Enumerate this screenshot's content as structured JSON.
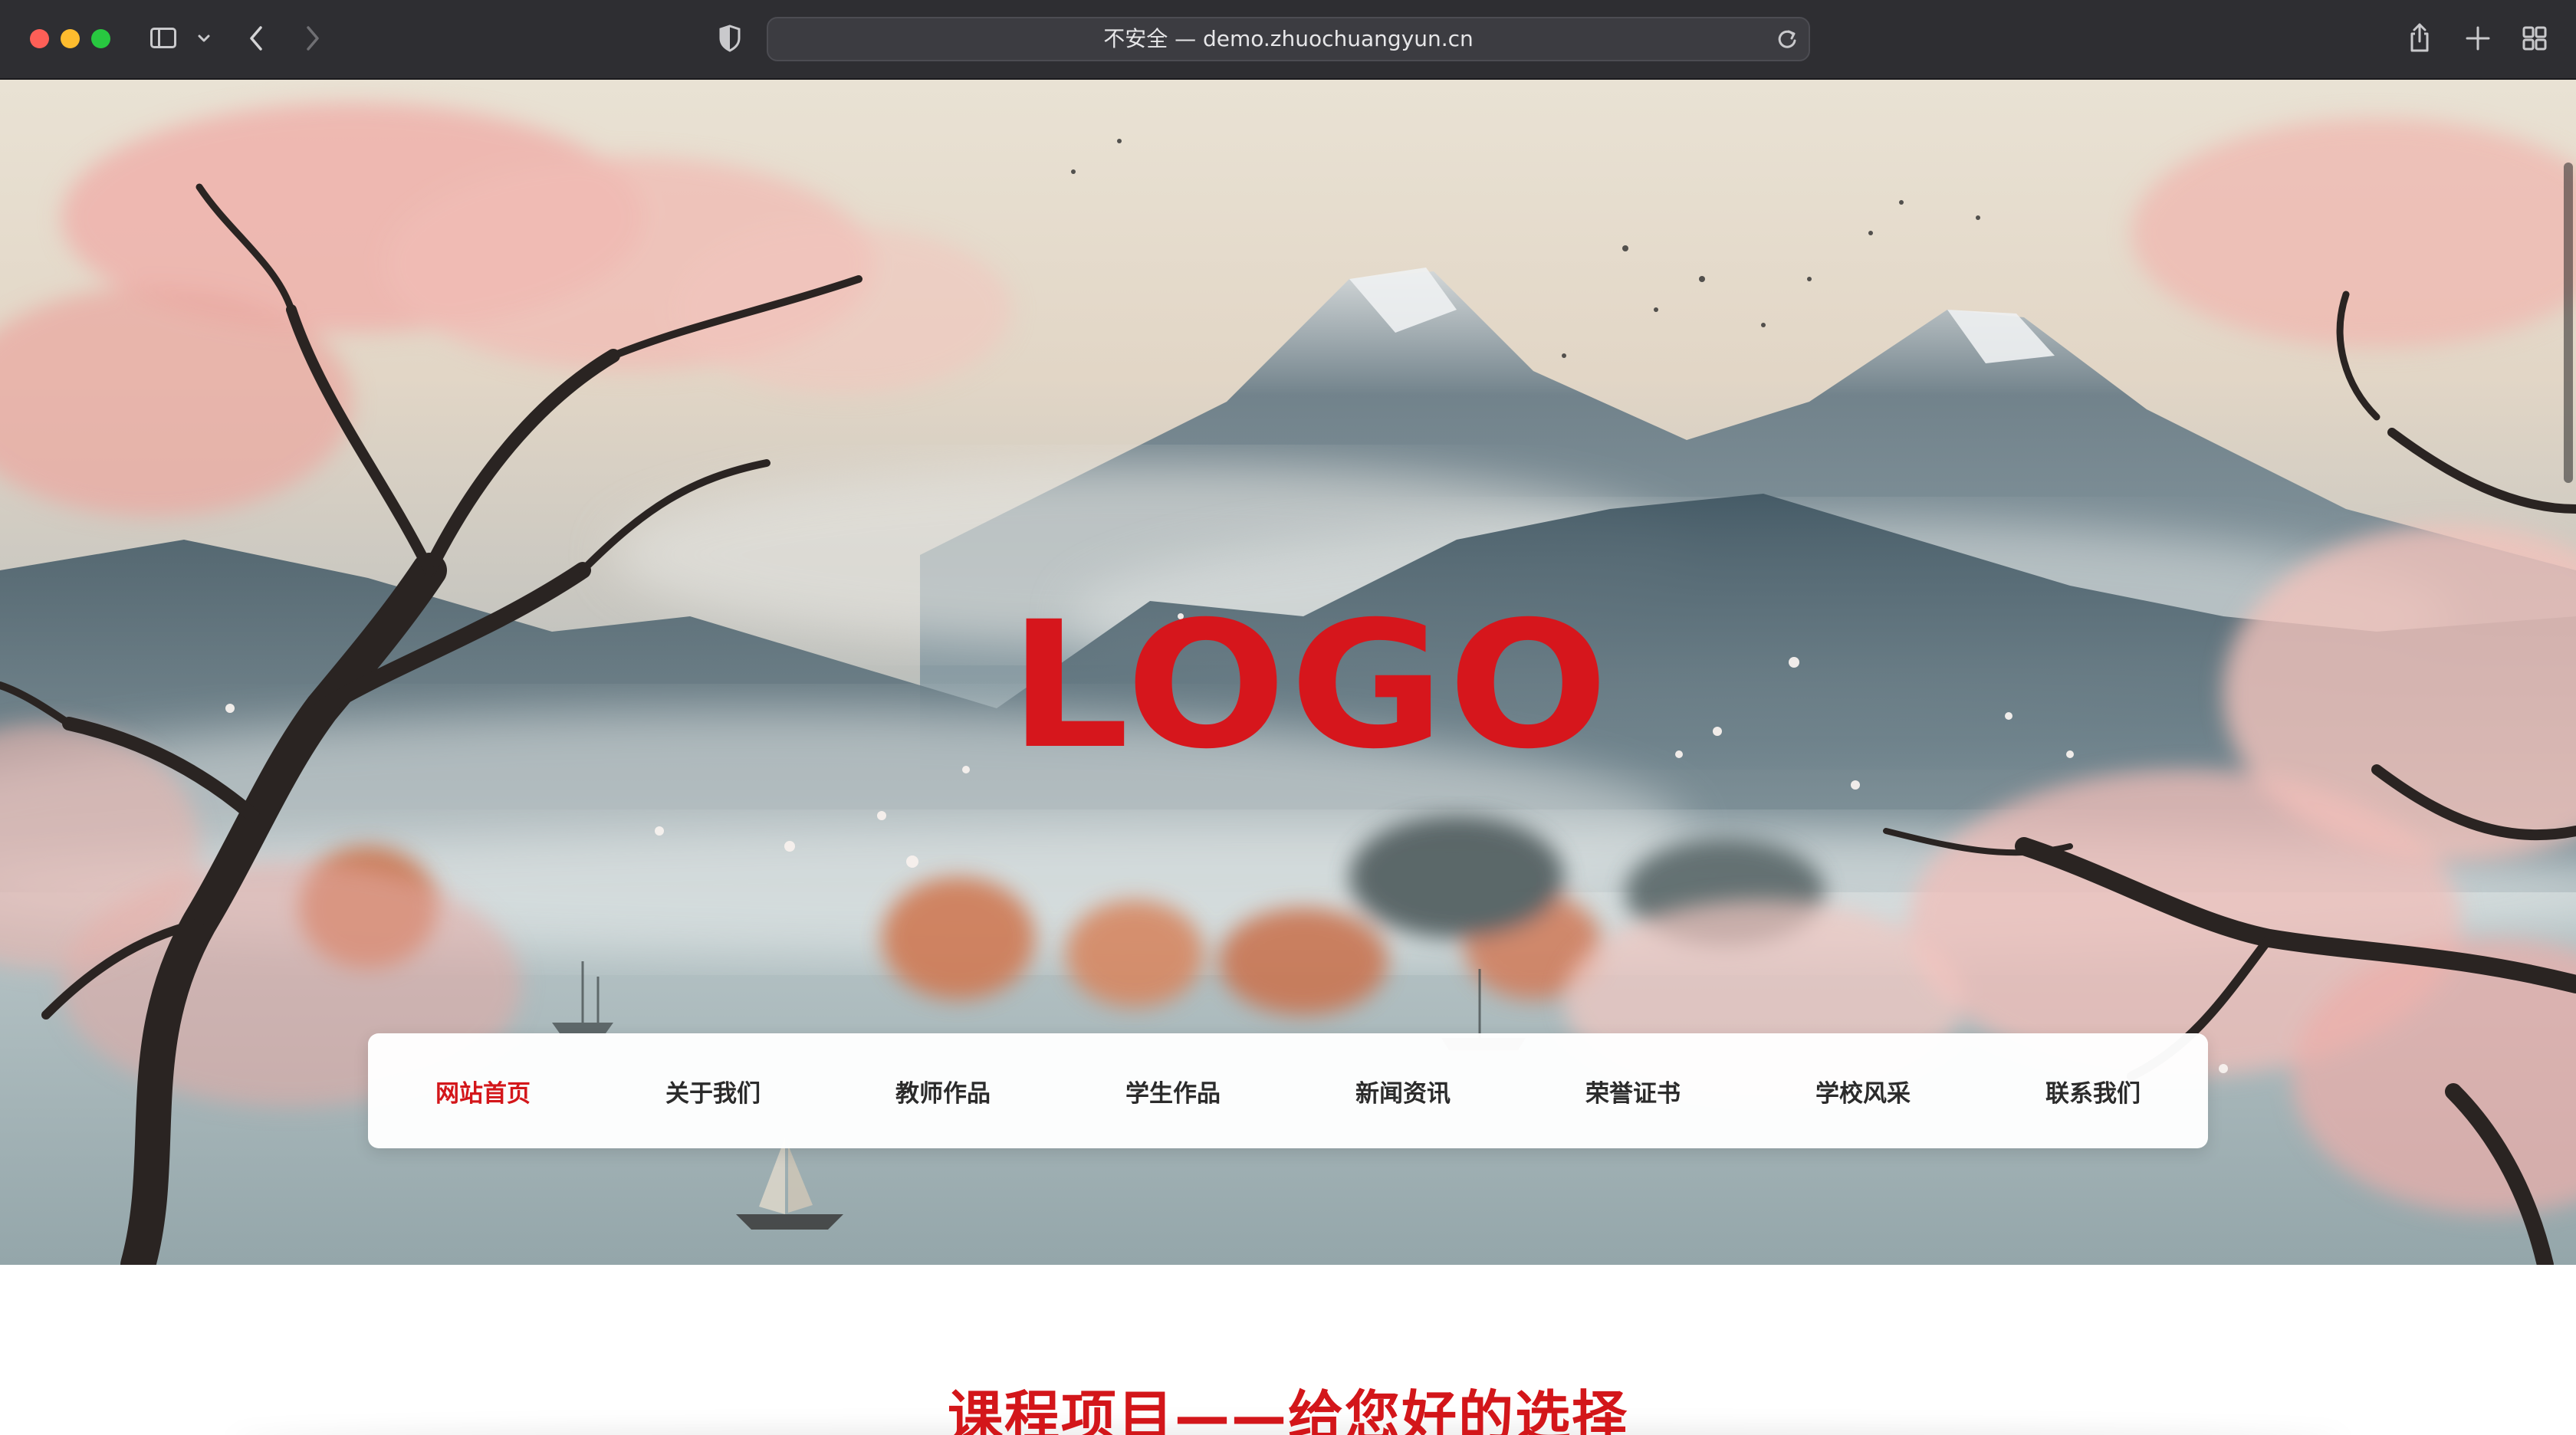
{
  "browser": {
    "url_text": "不安全 — demo.zhuochuangyun.cn"
  },
  "icons": {
    "sidebar": "sidebar-icon",
    "back": "chevron-left-icon",
    "forward": "chevron-right-icon",
    "privacy": "shield-icon",
    "reload": "reload-icon",
    "share": "share-icon",
    "new_tab": "plus-icon",
    "tab_overview": "tabs-grid-icon"
  },
  "hero": {
    "logo_text": "LOGO",
    "logo_color": "#d6161c"
  },
  "nav": {
    "items": [
      {
        "label": "网站首页",
        "active": true
      },
      {
        "label": "关于我们",
        "active": false
      },
      {
        "label": "教师作品",
        "active": false
      },
      {
        "label": "学生作品",
        "active": false
      },
      {
        "label": "新闻资讯",
        "active": false
      },
      {
        "label": "荣誉证书",
        "active": false
      },
      {
        "label": "学校风采",
        "active": false
      },
      {
        "label": "联系我们",
        "active": false
      }
    ],
    "active_color": "#d3161a"
  },
  "section": {
    "title": "课程项目——给您好的选择"
  }
}
